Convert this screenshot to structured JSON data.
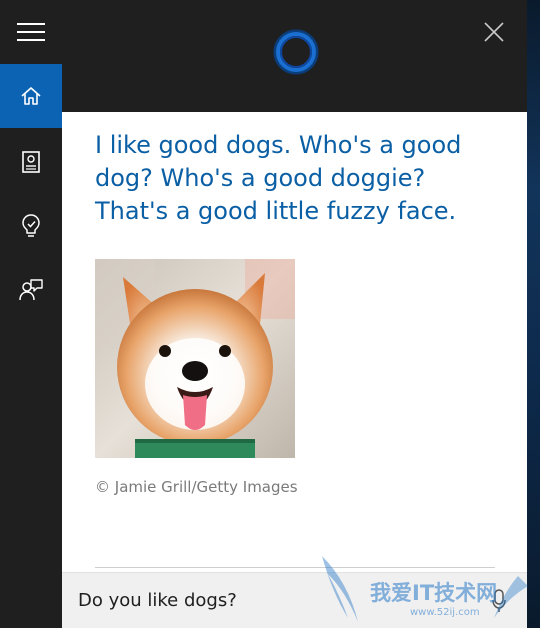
{
  "app": {
    "name": "Cortana"
  },
  "nav": {
    "items": [
      {
        "name": "menu",
        "icon": "hamburger-icon"
      },
      {
        "name": "home",
        "icon": "home-icon",
        "selected": true
      },
      {
        "name": "notebook",
        "icon": "notebook-icon"
      },
      {
        "name": "reminders",
        "icon": "lightbulb-icon"
      },
      {
        "name": "feedback",
        "icon": "feedback-icon"
      }
    ]
  },
  "header": {
    "logo_icon": "cortana-ring-icon",
    "close_icon": "close-icon"
  },
  "response": {
    "text": "I like good dogs. Who's a good dog? Who's a good doggie? That's a good little fuzzy face.",
    "image_subject": "yorkshire-terrier-photo",
    "credit": "© Jamie Grill/Getty Images"
  },
  "query": {
    "text": "Do you like dogs?",
    "mic_icon": "microphone-icon"
  },
  "watermark": {
    "text": "我爱IT技术网",
    "url": "www.52ij.com"
  },
  "colors": {
    "accent": "#0d63b3",
    "response_text": "#0b5fa5",
    "chrome": "#1f1f1f",
    "panel": "#ffffff",
    "query_bar": "#f0f0f0",
    "ring": "#1565c0"
  }
}
